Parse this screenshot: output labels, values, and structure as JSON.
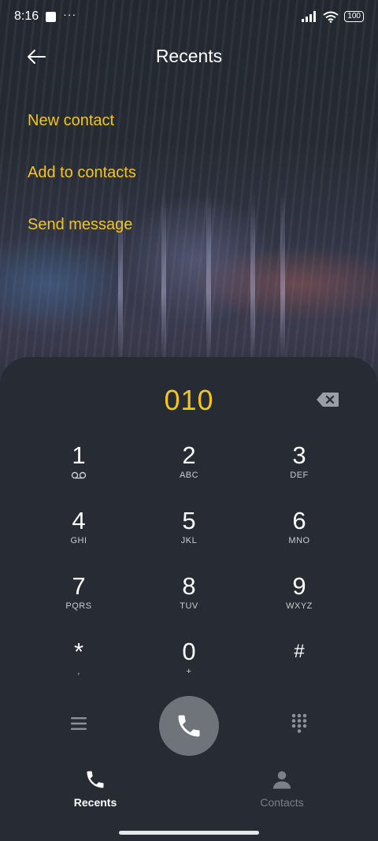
{
  "status_bar": {
    "time": "8:16",
    "dots": "···",
    "battery": "100"
  },
  "header": {
    "title": "Recents"
  },
  "menu": {
    "new_contact": "New contact",
    "add_to_contacts": "Add to contacts",
    "send_message": "Send message"
  },
  "dialer": {
    "number": "010",
    "keys": [
      {
        "digit": "1",
        "letters": ""
      },
      {
        "digit": "2",
        "letters": "ABC"
      },
      {
        "digit": "3",
        "letters": "DEF"
      },
      {
        "digit": "4",
        "letters": "GHI"
      },
      {
        "digit": "5",
        "letters": "JKL"
      },
      {
        "digit": "6",
        "letters": "MNO"
      },
      {
        "digit": "7",
        "letters": "PQRS"
      },
      {
        "digit": "8",
        "letters": "TUV"
      },
      {
        "digit": "9",
        "letters": "WXYZ"
      },
      {
        "digit": "*",
        "letters": ","
      },
      {
        "digit": "0",
        "letters": "+"
      },
      {
        "digit": "#",
        "letters": ""
      }
    ]
  },
  "nav": {
    "recents": "Recents",
    "contacts": "Contacts"
  },
  "colors": {
    "accent": "#f5c518",
    "background": "#262b34",
    "call_button": "#6f747b",
    "inactive": "#7b8089"
  },
  "icons": {
    "back": "arrow-left-icon",
    "backspace": "backspace-icon",
    "voicemail": "voicemail-icon",
    "menu": "hamburger-menu-icon",
    "call": "phone-icon",
    "keypad": "dialpad-icon",
    "recents_tab": "phone-icon",
    "contacts_tab": "person-icon"
  }
}
